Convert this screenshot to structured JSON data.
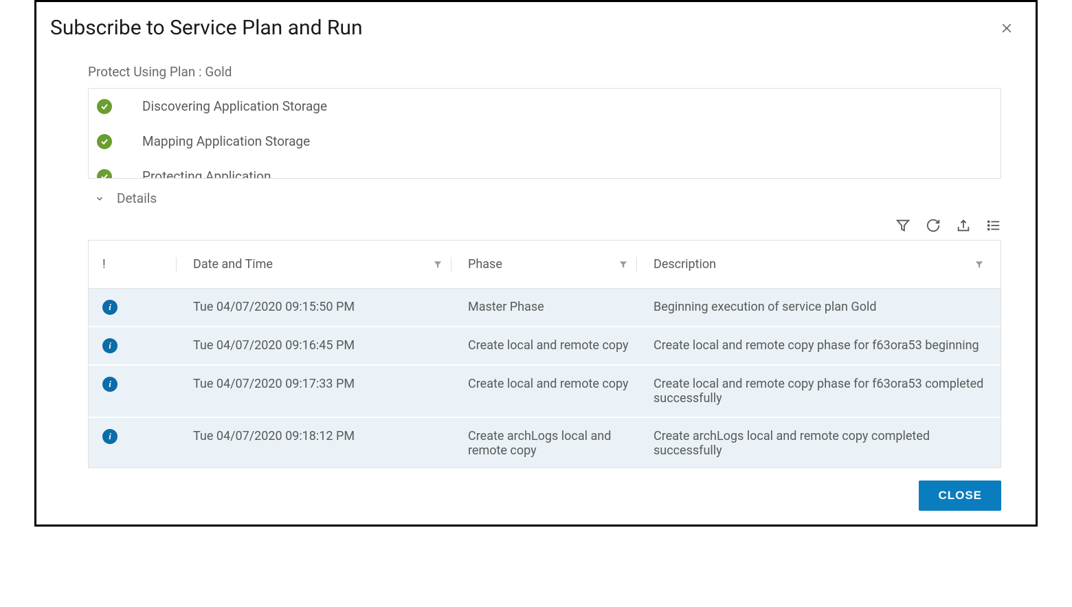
{
  "modal": {
    "title": "Subscribe to Service Plan and Run",
    "plan_label": "Protect Using Plan : Gold"
  },
  "steps": [
    {
      "label": "Discovering Application Storage"
    },
    {
      "label": "Mapping Application Storage"
    },
    {
      "label": "Protecting Application"
    }
  ],
  "details": {
    "label": "Details"
  },
  "table": {
    "headers": {
      "status": "!",
      "datetime": "Date and Time",
      "phase": "Phase",
      "description": "Description"
    },
    "rows": [
      {
        "datetime": "Tue 04/07/2020 09:15:50 PM",
        "phase": "Master Phase",
        "description": "Beginning execution of service plan Gold"
      },
      {
        "datetime": "Tue 04/07/2020 09:16:45 PM",
        "phase": "Create local and remote copy",
        "description": "Create local and remote copy phase for f63ora53 beginning"
      },
      {
        "datetime": "Tue 04/07/2020 09:17:33 PM",
        "phase": "Create local and remote copy",
        "description": "Create local and remote copy phase for f63ora53 completed successfully"
      },
      {
        "datetime": "Tue 04/07/2020 09:18:12 PM",
        "phase": "Create archLogs local and remote copy",
        "description": "Create archLogs local and remote copy completed successfully"
      }
    ]
  },
  "footer": {
    "close": "CLOSE"
  }
}
